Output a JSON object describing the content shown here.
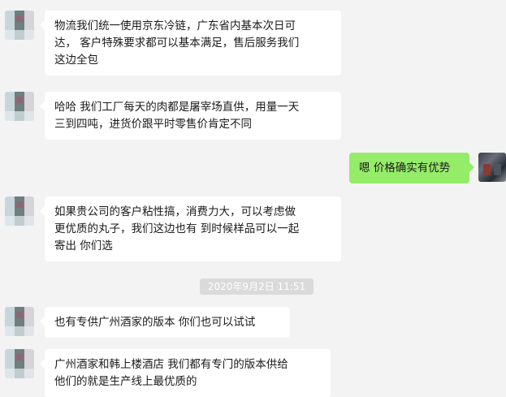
{
  "messages": [
    {
      "side": "left",
      "text": "物流我们统一使用京东冷链，广东省内基本次日可\n达， 客户特殊要求都可以基本满足，售后服务我们\n这边全包"
    },
    {
      "side": "left",
      "text": "哈哈 我们工厂每天的肉都是屠宰场直供，用量一天\n三到四吨，进货价跟平时零售价肯定不同"
    },
    {
      "side": "right",
      "text": "嗯 价格确实有优势"
    },
    {
      "side": "left",
      "text": "如果贵公司的客户粘性搞，消费力大，可以考虑做\n更优质的丸子，我们这边也有 到时候样品可以一起\n寄出 你们选"
    },
    {
      "side": "left",
      "text": "也有专供广州酒家的版本 你们也可以试试"
    },
    {
      "side": "left",
      "text": "广州酒家和韩上楼酒店 我们都有专门的版本供给\n他们的就是生产线上最优质的"
    }
  ],
  "timestamp": "2020年9月2日 11:51",
  "colors": {
    "background": "#f3f3f3",
    "bubble_left": "#ffffff",
    "bubble_right": "#95ec69",
    "timestamp_bg": "#dadada",
    "text": "#1a1a1a"
  }
}
